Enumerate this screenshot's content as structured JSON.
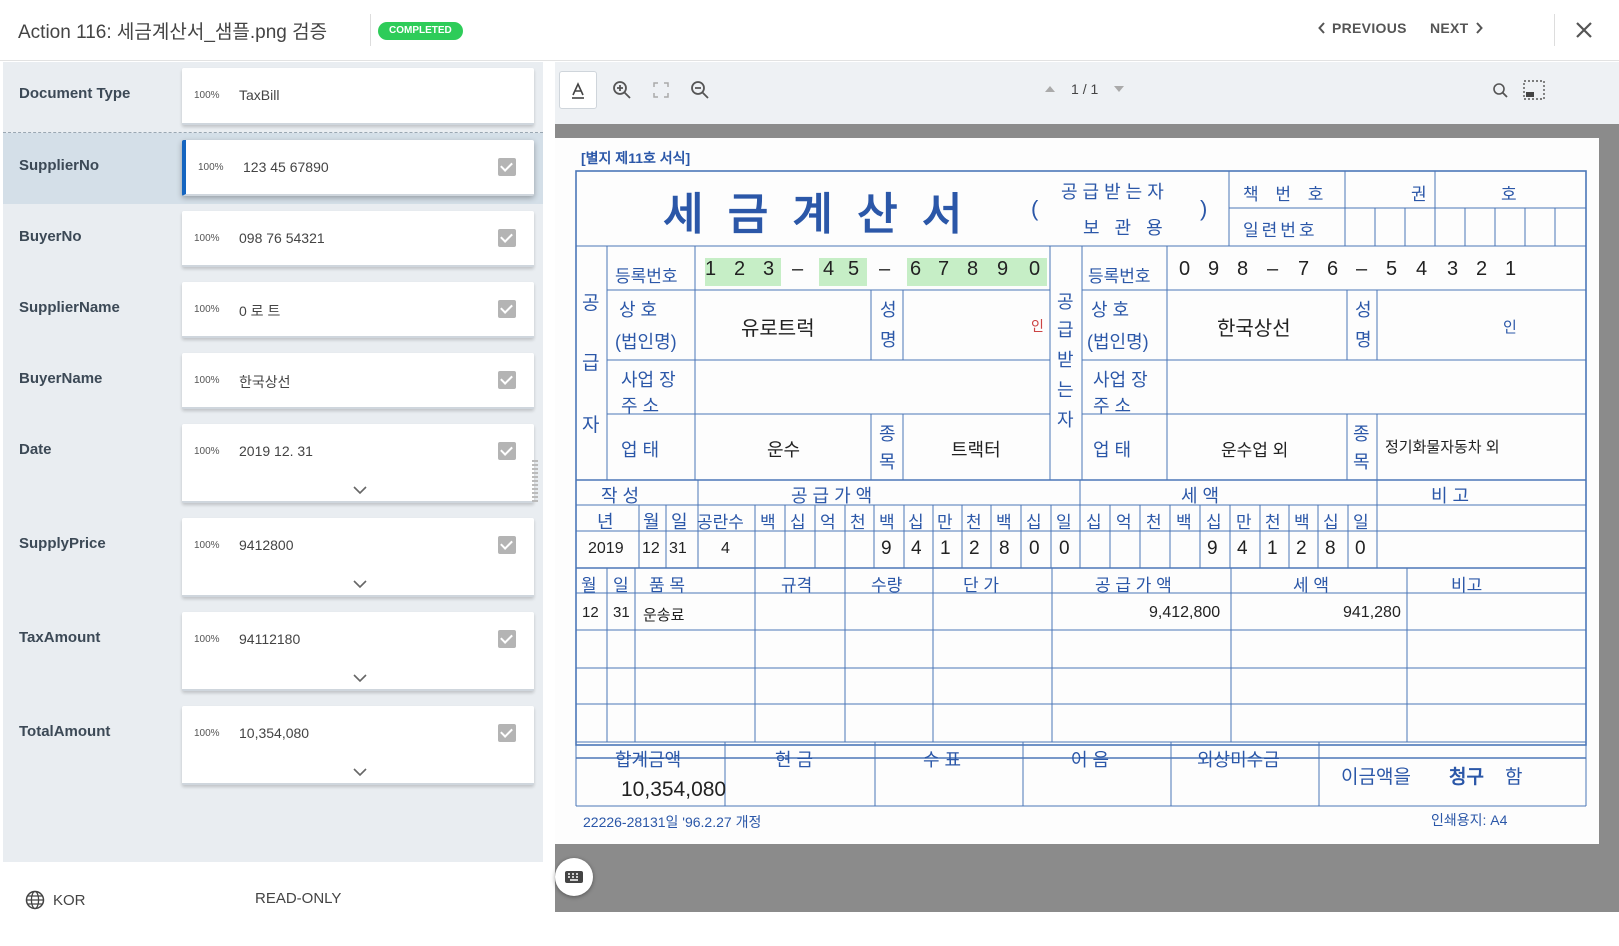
{
  "header": {
    "title": "Action 116: 세금계산서_샘플.png 검증",
    "status": "COMPLETED",
    "status_color": "#2ecc59",
    "previous_label": "PREVIOUS",
    "next_label": "NEXT"
  },
  "fields": [
    {
      "name": "Document Type",
      "confidence": "100%",
      "value": "TaxBill",
      "checked": false,
      "dropdown": false
    },
    {
      "name": "SupplierNo",
      "confidence": "100%",
      "value": "123 45 67890",
      "checked": true,
      "dropdown": false
    },
    {
      "name": "BuyerNo",
      "confidence": "100%",
      "value": "098 76 54321",
      "checked": true,
      "dropdown": false
    },
    {
      "name": "SupplierName",
      "confidence": "100%",
      "value": "0 로 트",
      "checked": true,
      "dropdown": false
    },
    {
      "name": "BuyerName",
      "confidence": "100%",
      "value": "한국상선",
      "checked": true,
      "dropdown": false
    },
    {
      "name": "Date",
      "confidence": "100%",
      "value": "2019 12. 31",
      "checked": true,
      "dropdown": true
    },
    {
      "name": "SupplyPrice",
      "confidence": "100%",
      "value": "9412800",
      "checked": true,
      "dropdown": true
    },
    {
      "name": "TaxAmount",
      "confidence": "100%",
      "value": "94112180",
      "checked": true,
      "dropdown": true
    },
    {
      "name": "TotalAmount",
      "confidence": "100%",
      "value": "10,354,080",
      "checked": true,
      "dropdown": true
    }
  ],
  "footer": {
    "language": "KOR",
    "mode": "READ-ONLY"
  },
  "viewer": {
    "page_current": "1",
    "page_sep": "/",
    "page_total": "1"
  },
  "document": {
    "form_code": "[별지 제11호 서식]",
    "title": "세 금 계 산 서",
    "paren_open": "(",
    "paren_close": ")",
    "receiver_copy_1": "공급받는자",
    "receiver_copy_2": "보 관 용",
    "book_no_label": "책 번 호",
    "vol_label": "권",
    "ho_label": "호",
    "serial_label": "일련번호",
    "supplier_side": [
      "공",
      "급",
      "자"
    ],
    "buyer_side": [
      "공",
      "급",
      "받",
      "는",
      "자"
    ],
    "reg_no_label": "등록번호",
    "supplier_reg_digits": [
      "1",
      "2",
      "3",
      "–",
      "4",
      "5",
      "–",
      "6",
      "7",
      "8",
      "9",
      "0"
    ],
    "buyer_reg_digits": [
      "0",
      "9",
      "8",
      "–",
      "7",
      "6",
      "–",
      "5",
      "4",
      "3",
      "2",
      "1"
    ],
    "company_label_1": "상   호",
    "company_label_2": "(법인명)",
    "name_label_1": "성",
    "name_label_2": "명",
    "supplier_company": "유로트럭",
    "supplier_seal": "인",
    "buyer_company": "한국상선",
    "buyer_seal": "인",
    "address_label_1": "사업 장",
    "address_label_2": "주   소",
    "business_type_label": "업   태",
    "item_label_1": "종",
    "item_label_2": "목",
    "supplier_business": "운수",
    "supplier_item": "트랙터",
    "buyer_business": "운수업 외",
    "buyer_item": "정기화물자동차 외",
    "written_label": "작   성",
    "supply_value_label": "공    급    가    액",
    "tax_label": "세        액",
    "remarks_label": "비 고",
    "date_cols": [
      "년",
      "월",
      "일"
    ],
    "blank_label": "공란수",
    "unit_cols_supply": [
      "백",
      "십",
      "억",
      "천",
      "백",
      "십",
      "만",
      "천",
      "백",
      "십",
      "일"
    ],
    "unit_cols_tax": [
      "십",
      "억",
      "천",
      "백",
      "십",
      "만",
      "천",
      "백",
      "십",
      "일"
    ],
    "year": "2019",
    "month": "12",
    "day": "31",
    "blank_count": "4",
    "supply_digits": [
      "9",
      "4",
      "1",
      "2",
      "8",
      "0",
      "0"
    ],
    "tax_digits": [
      "9",
      "4",
      "1",
      "2",
      "8",
      "0"
    ],
    "item_headers": [
      "월",
      "일",
      "품          목",
      "규격",
      "수량",
      "단    가",
      "공 급 가 액",
      "세    액",
      "비고"
    ],
    "item_row": {
      "month": "12",
      "day": "31",
      "item": "운송료",
      "supply": "9,412,800",
      "tax": "941,280"
    },
    "total_label": "합계금액",
    "cash_label": "현   금",
    "check_label": "수   표",
    "note_label": "어   음",
    "credit_label": "외상미수금",
    "total_value": "10,354,080",
    "claim_text_1": "이금액을",
    "claim_text_2": "청구",
    "claim_text_3": "함",
    "form_number": "22226-28131일 '96.2.27 개정",
    "paper_size": "인쇄용지: A4"
  }
}
